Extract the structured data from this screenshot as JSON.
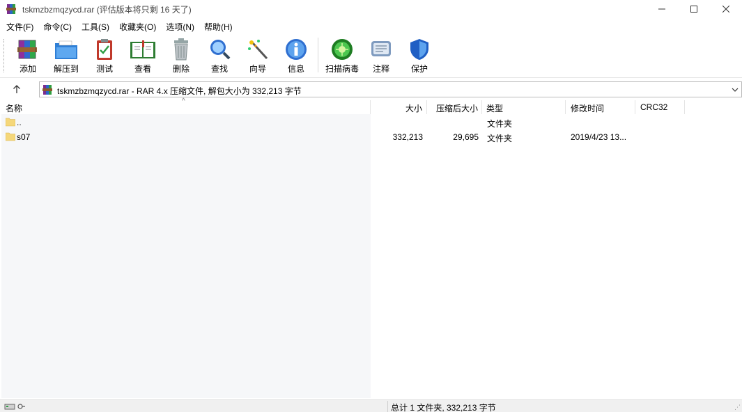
{
  "window": {
    "title": "tskmzbzmqzycd.rar (评估版本将只剩 16 天了)",
    "minimize_icon": "minimize-icon",
    "maximize_icon": "maximize-icon",
    "close_icon": "close-icon"
  },
  "menu": [
    {
      "label": "文件(F)"
    },
    {
      "label": "命令(C)"
    },
    {
      "label": "工具(S)"
    },
    {
      "label": "收藏夹(O)"
    },
    {
      "label": "选项(N)"
    },
    {
      "label": "帮助(H)"
    }
  ],
  "toolbar": {
    "add": "添加",
    "extract": "解压到",
    "test": "测试",
    "view": "查看",
    "delete": "删除",
    "find": "查找",
    "wizard": "向导",
    "info": "信息",
    "scan": "扫描病毒",
    "comment": "注释",
    "protect": "保护"
  },
  "address": {
    "text": "tskmzbzmqzycd.rar - RAR 4.x 压缩文件, 解包大小为 332,213 字节"
  },
  "columns": {
    "name": "名称",
    "size": "大小",
    "packed": "压缩后大小",
    "type": "类型",
    "modified": "修改时间",
    "crc": "CRC32"
  },
  "rows": [
    {
      "name": "..",
      "size": "",
      "packed": "",
      "type": "文件夹",
      "modified": ""
    },
    {
      "name": "s07",
      "size": "332,213",
      "packed": "29,695",
      "type": "文件夹",
      "modified": "2019/4/23 13..."
    }
  ],
  "status": {
    "text": "总计 1 文件夹, 332,213 字节"
  },
  "colors": {
    "name_panel_bg": "#f6f7f9",
    "folder": "#f5d77a"
  }
}
